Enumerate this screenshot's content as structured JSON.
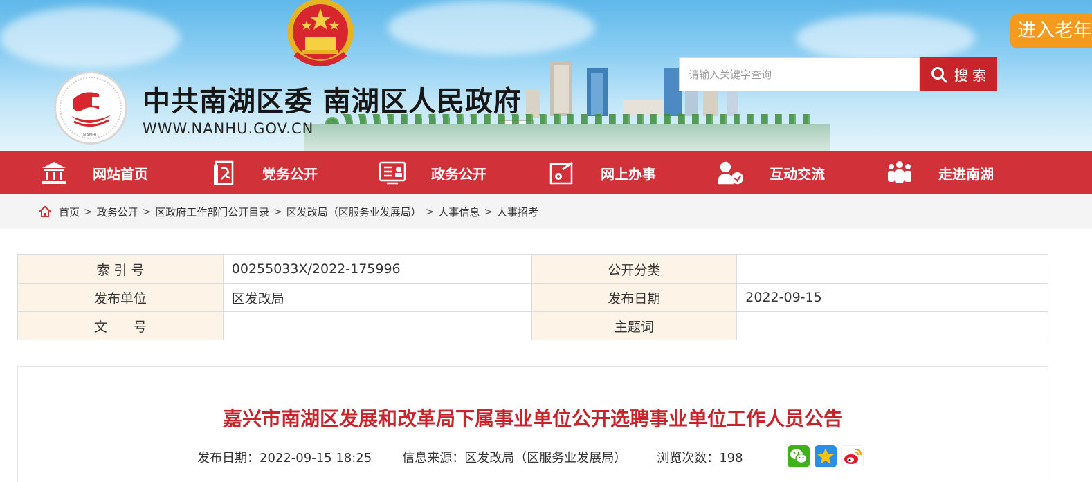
{
  "header": {
    "site_title": "中共南湖区委 南湖区人民政府",
    "site_url": "WWW.NANHU.GOV.CN",
    "logo_text": "NANHU",
    "search_placeholder": "请输入关键字查询",
    "search_button": "搜 索",
    "elder_mode": "进入老年"
  },
  "nav": {
    "items": [
      {
        "label": "网站首页",
        "icon": "building-icon"
      },
      {
        "label": "党务公开",
        "icon": "party-flag-icon"
      },
      {
        "label": "政务公开",
        "icon": "document-board-icon"
      },
      {
        "label": "网上办事",
        "icon": "online-service-icon"
      },
      {
        "label": "互动交流",
        "icon": "user-chat-icon"
      },
      {
        "label": "走进南湖",
        "icon": "people-group-icon"
      }
    ]
  },
  "breadcrumb": [
    "首页",
    "政务公开",
    "区政府工作部门公开目录",
    "区发改局（区服务业发展局）",
    "人事信息",
    "人事招考"
  ],
  "meta": {
    "index_label": "索 引 号",
    "index_value": "00255033X/2022-175996",
    "category_label": "公开分类",
    "category_value": "",
    "publisher_label": "发布单位",
    "publisher_value": "区发改局",
    "date_label": "发布日期",
    "date_value": "2022-09-15",
    "doc_no_label": "文　　号",
    "doc_no_value": "",
    "subject_label": "主题词",
    "subject_value": ""
  },
  "article": {
    "title": "嘉兴市南湖区发展和改革局下属事业单位公开选聘事业单位工作人员公告",
    "date_label": "发布日期：",
    "date_value": "2022-09-15 18:25",
    "source_label": "信息来源：",
    "source_value": "区发改局（区服务业发展局）",
    "views_label": "浏览次数：",
    "views_value": "198"
  },
  "colors": {
    "brand_red": "#d1323a",
    "title_red": "#c8242c",
    "label_bg": "#fdf3e7",
    "elder_orange": "#f39a1f"
  }
}
